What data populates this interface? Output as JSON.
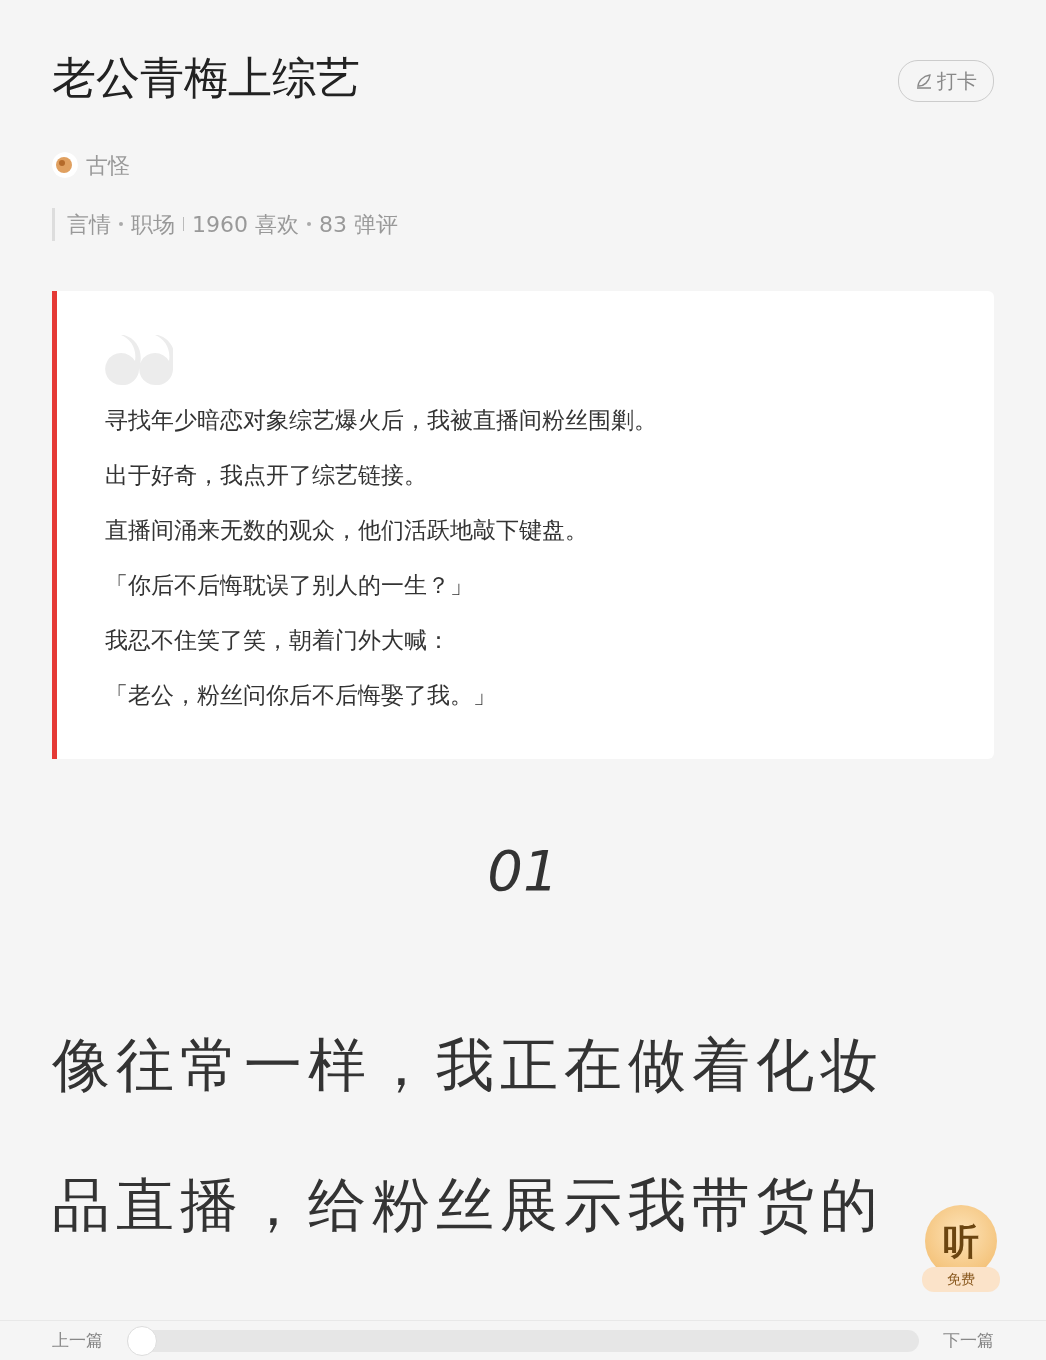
{
  "title": "老公青梅上综艺",
  "checkin_button": {
    "label": "打卡"
  },
  "author": {
    "name": "古怪"
  },
  "meta": {
    "tags": [
      "言情",
      "职场"
    ],
    "likes": "1960 喜欢",
    "comments": "83 弹评"
  },
  "summary": [
    "寻找年少暗恋对象综艺爆火后，我被直播间粉丝围剿。",
    "出于好奇，我点开了综艺链接。",
    "直播间涌来无数的观众，他们活跃地敲下键盘。",
    "「你后不后悔耽误了别人的一生？」",
    "我忍不住笑了笑，朝着门外大喊：",
    "「老公，粉丝问你后不后悔娶了我。」"
  ],
  "chapter_number": "01",
  "body": "像往常一样，我正在做着化妆品直播，给粉丝展示我带货的",
  "listen_button": {
    "label": "听",
    "badge": "免费"
  },
  "bottom_bar": {
    "prev": "上一篇",
    "next": "下一篇",
    "progress": {
      "level": 0
    }
  }
}
